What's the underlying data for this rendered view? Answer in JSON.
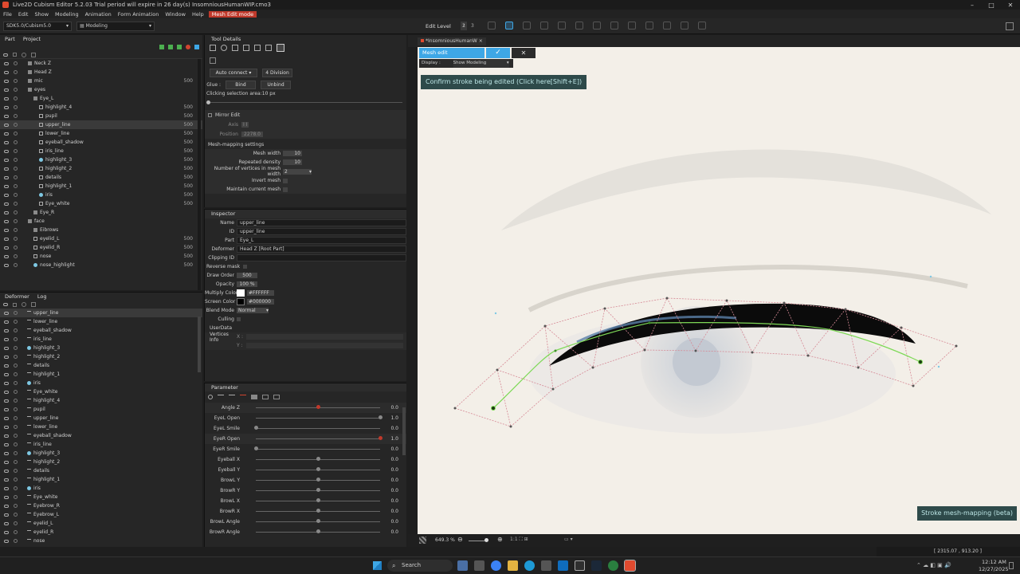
{
  "window": {
    "title": "Live2D Cubism Editor 5.2.03   Trial period will expire in 26 day(s)   InsomniousHumanWIP.cmo3",
    "controls": [
      "–",
      "□",
      "✕"
    ]
  },
  "menu": {
    "items": [
      "File",
      "Edit",
      "Show",
      "Modeling",
      "Animation",
      "Form Animation",
      "Window",
      "Help"
    ],
    "mode_badge": "Mesh Edit mode"
  },
  "toolbar": {
    "sdk_select": "SDK5.0/Cubism5.0",
    "workspace_select": "Modeling",
    "edit_level_label": "Edit Level",
    "edit_levels": [
      "1",
      "2",
      "3"
    ]
  },
  "part_panel": {
    "tabs": [
      "Part",
      "Project"
    ],
    "rows": [
      {
        "label": "Neck Z",
        "order": "",
        "indent": 1,
        "icon": "folder"
      },
      {
        "label": "Head Z",
        "order": "",
        "indent": 1,
        "icon": "folder"
      },
      {
        "label": "mic",
        "order": "500",
        "indent": 1,
        "icon": "folder"
      },
      {
        "label": "eyes",
        "order": "",
        "indent": 1,
        "icon": "folder"
      },
      {
        "label": "Eye_L",
        "order": "",
        "indent": 2,
        "icon": "folder"
      },
      {
        "label": "highlight_4",
        "order": "500",
        "indent": 3,
        "icon": "art"
      },
      {
        "label": "pupil",
        "order": "500",
        "indent": 3,
        "icon": "art"
      },
      {
        "label": "upper_line",
        "order": "500",
        "indent": 3,
        "icon": "art",
        "selected": true
      },
      {
        "label": "lower_line",
        "order": "500",
        "indent": 3,
        "icon": "art"
      },
      {
        "label": "eyeball_shadow",
        "order": "500",
        "indent": 3,
        "icon": "art"
      },
      {
        "label": "iris_line",
        "order": "500",
        "indent": 3,
        "icon": "art"
      },
      {
        "label": "highlight_3",
        "order": "500",
        "indent": 3,
        "icon": "dot"
      },
      {
        "label": "highlight_2",
        "order": "500",
        "indent": 3,
        "icon": "art"
      },
      {
        "label": "details",
        "order": "500",
        "indent": 3,
        "icon": "art"
      },
      {
        "label": "highlight_1",
        "order": "500",
        "indent": 3,
        "icon": "art"
      },
      {
        "label": "iris",
        "order": "500",
        "indent": 3,
        "icon": "dot"
      },
      {
        "label": "Eye_white",
        "order": "500",
        "indent": 3,
        "icon": "art"
      },
      {
        "label": "Eye_R",
        "order": "",
        "indent": 2,
        "icon": "folder"
      },
      {
        "label": "face",
        "order": "",
        "indent": 1,
        "icon": "folder"
      },
      {
        "label": "Eibrows",
        "order": "",
        "indent": 2,
        "icon": "folder"
      },
      {
        "label": "eyelid_L",
        "order": "500",
        "indent": 2,
        "icon": "art"
      },
      {
        "label": "eyelid_R",
        "order": "500",
        "indent": 2,
        "icon": "art"
      },
      {
        "label": "nose",
        "order": "500",
        "indent": 2,
        "icon": "art"
      },
      {
        "label": "nose_highlight",
        "order": "500",
        "indent": 2,
        "icon": "dot"
      }
    ]
  },
  "deformer_panel": {
    "tabs": [
      "Deformer",
      "Log"
    ],
    "rows": [
      {
        "label": "upper_line",
        "selected": true,
        "icon": "art"
      },
      {
        "label": "lower_line",
        "icon": "art"
      },
      {
        "label": "eyeball_shadow",
        "icon": "art"
      },
      {
        "label": "iris_line",
        "icon": "art"
      },
      {
        "label": "highlight_3",
        "icon": "dot"
      },
      {
        "label": "highlight_2",
        "icon": "art"
      },
      {
        "label": "details",
        "icon": "art"
      },
      {
        "label": "highlight_1",
        "icon": "art"
      },
      {
        "label": "iris",
        "icon": "dot"
      },
      {
        "label": "Eye_white",
        "icon": "art"
      },
      {
        "label": "highlight_4",
        "icon": "art"
      },
      {
        "label": "pupil",
        "icon": "art"
      },
      {
        "label": "upper_line",
        "icon": "art"
      },
      {
        "label": "lower_line",
        "icon": "art"
      },
      {
        "label": "eyeball_shadow",
        "icon": "art"
      },
      {
        "label": "iris_line",
        "icon": "art"
      },
      {
        "label": "highlight_3",
        "icon": "dot"
      },
      {
        "label": "highlight_2",
        "icon": "art"
      },
      {
        "label": "details",
        "icon": "art"
      },
      {
        "label": "highlight_1",
        "icon": "art"
      },
      {
        "label": "iris",
        "icon": "dot"
      },
      {
        "label": "Eye_white",
        "icon": "art"
      },
      {
        "label": "Eyebrow_R",
        "icon": "art"
      },
      {
        "label": "Eyebrow_L",
        "icon": "art"
      },
      {
        "label": "eyelid_L",
        "icon": "art"
      },
      {
        "label": "eyelid_R",
        "icon": "art"
      },
      {
        "label": "nose",
        "icon": "art"
      }
    ]
  },
  "tool_details": {
    "title": "Tool Details",
    "auto_connect": "Auto connect",
    "division": "4 Division",
    "glue_label": "Glue :",
    "bind": "Bind",
    "unbind": "Unbind",
    "clicking_area": "Clicking selection area:10 px",
    "mirror_edit": "Mirror Edit",
    "axis_label": "Axis",
    "axis_value": "I I",
    "position_label": "Position",
    "position_value": "2278.0",
    "mesh_mapping": "Mesh-mapping settings",
    "mesh_width_label": "Mesh width",
    "mesh_width": "10",
    "repeated_density_label": "Repeated density",
    "repeated_density": "10",
    "num_vertices_label": "Number of vertices in mesh width",
    "num_vertices": "2",
    "invert_mesh": "Invert mesh",
    "maintain_mesh": "Maintain current mesh"
  },
  "inspector": {
    "title": "Inspector",
    "fields": [
      {
        "key": "Name",
        "value": "upper_line"
      },
      {
        "key": "ID",
        "value": "upper_line"
      },
      {
        "key": "Part",
        "value": "Eye_L"
      },
      {
        "key": "Deformer",
        "value": "Head Z  [Root Part]"
      },
      {
        "key": "Clipping ID",
        "value": ""
      }
    ],
    "reverse_mask": "Reverse mask",
    "draw_order_label": "Draw Order",
    "draw_order": "500",
    "opacity_label": "Opacity",
    "opacity": "100 %",
    "multiply_label": "Multiply Color",
    "multiply_value": "#FFFFFF",
    "screen_label": "Screen Color",
    "screen_value": "#000000",
    "blend_label": "Blend Mode",
    "blend_value": "Normal",
    "culling": "Culling",
    "userdata": "UserData",
    "vertices_info": "Vertices Info",
    "vx": "X :",
    "vy": "Y :"
  },
  "parameter": {
    "title": "Parameter",
    "rows": [
      {
        "name": "Angle Z",
        "value": "0.0",
        "level": 0.5,
        "highlight": true
      },
      {
        "name": "EyeL Open",
        "value": "1.0",
        "level": 1.0
      },
      {
        "name": "EyeL Smile",
        "value": "0.0",
        "level": 0.0
      },
      {
        "name": "EyeR Open",
        "value": "1.0",
        "level": 1.0,
        "highlight": true
      },
      {
        "name": "EyeR Smile",
        "value": "0.0",
        "level": 0.0
      },
      {
        "name": "Eyeball X",
        "value": "0.0",
        "level": 0.5
      },
      {
        "name": "Eyeball Y",
        "value": "0.0",
        "level": 0.5
      },
      {
        "name": "BrowL Y",
        "value": "0.0",
        "level": 0.5
      },
      {
        "name": "BrowR Y",
        "value": "0.0",
        "level": 0.5
      },
      {
        "name": "BrowL X",
        "value": "0.0",
        "level": 0.5
      },
      {
        "name": "BrowR X",
        "value": "0.0",
        "level": 0.5
      },
      {
        "name": "BrowL Angle",
        "value": "0.0",
        "level": 0.5
      },
      {
        "name": "BrowR Angle",
        "value": "0.0",
        "level": 0.5
      }
    ]
  },
  "canvas": {
    "tab": "*InsomniousHumanW",
    "mesh_edit": "Mesh edit",
    "display_label": "Display :",
    "display_value": "Show Modeling",
    "confirm_banner": "Confirm stroke being edited (Click here[Shift+E])",
    "stroke_badge": "Stroke mesh-mapping (beta)",
    "zoom": "649.3 %",
    "coords": "[ 2315.07 , 913.20 ]"
  },
  "taskbar": {
    "search": "Search",
    "time": "12:12 AM",
    "date": "12/27/2025"
  },
  "colors": {
    "mode_red": "#c0392b",
    "mesh_edit_blue": "#3ea7e6",
    "confirm_teal": "#2e4a4a",
    "mesh_pink": "#d68a96",
    "stroke_green": "#7ed957"
  }
}
